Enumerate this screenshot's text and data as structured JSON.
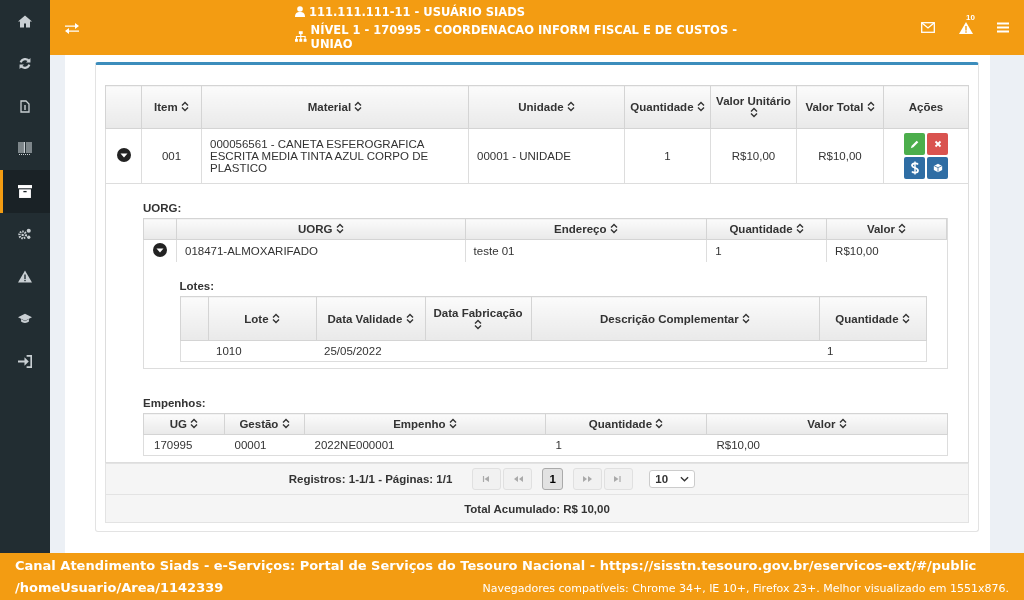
{
  "sidebar": {
    "items": [
      {
        "selected": false
      },
      {
        "selected": false
      },
      {
        "selected": false
      },
      {
        "selected": false
      },
      {
        "selected": true
      },
      {
        "selected": false
      },
      {
        "selected": false
      },
      {
        "selected": false
      },
      {
        "selected": false
      }
    ]
  },
  "header": {
    "user": "111.111.111-11 - USUÁRIO SIADS",
    "level": "NÍVEL 1 - 170995 - COORDENACAO INFORM FISCAL E DE CUSTOS - UNIAO",
    "alerts_count": "10"
  },
  "items_table": {
    "columns": [
      {
        "label": "Item",
        "sortable": true
      },
      {
        "label": "Material",
        "sortable": true
      },
      {
        "label": "Unidade",
        "sortable": true
      },
      {
        "label": "Quantidade",
        "sortable": true
      },
      {
        "label": "Valor Unitário",
        "sortable": true
      },
      {
        "label": "Valor Total",
        "sortable": true
      },
      {
        "label": "Ações",
        "sortable": false
      }
    ],
    "rows": [
      {
        "expanded": true,
        "cells": [
          "001",
          "000056561 - CANETA ESFEROGRAFICA ESCRITA MEDIA TINTA AZUL CORPO DE PLASTICO",
          "00001 - UNIDADE",
          "1",
          "R$10,00",
          "R$10,00"
        ],
        "actions": [
          {
            "kind": "edit"
          },
          {
            "kind": "delete"
          },
          {
            "kind": "payment"
          },
          {
            "kind": "package"
          }
        ],
        "uorg": {
          "title": "UORG:",
          "columns": [
            {
              "label": "UORG",
              "sortable": true
            },
            {
              "label": "Endereço",
              "sortable": true
            },
            {
              "label": "Quantidade",
              "sortable": true
            },
            {
              "label": "Valor",
              "sortable": true
            }
          ],
          "rows": [
            {
              "expanded": true,
              "cells": [
                "018471-ALMOXARIFADO",
                "teste 01",
                "1",
                "R$10,00"
              ],
              "lotes": {
                "title": "Lotes:",
                "columns": [
                  {
                    "label": "Lote",
                    "sortable": true
                  },
                  {
                    "label": "Data Validade",
                    "sortable": true
                  },
                  {
                    "label": "Data Fabricação",
                    "sortable": true
                  },
                  {
                    "label": "Descrição Complementar",
                    "sortable": true
                  },
                  {
                    "label": "Quantidade",
                    "sortable": true
                  }
                ],
                "rows": [
                  {
                    "lote": "1010",
                    "data_validade": "25/05/2022",
                    "quantidade": "1"
                  }
                ]
              }
            }
          ]
        },
        "empenhos": {
          "title": "Empenhos:",
          "columns": [
            {
              "label": "UG",
              "sortable": true
            },
            {
              "label": "Gestão",
              "sortable": true
            },
            {
              "label": "Empenho",
              "sortable": true
            },
            {
              "label": "Quantidade",
              "sortable": true
            },
            {
              "label": "Valor",
              "sortable": true
            }
          ],
          "rows": [
            {
              "cells": [
                "170995",
                "00001",
                "2022NE000001",
                "1",
                "R$10,00"
              ]
            }
          ]
        }
      }
    ]
  },
  "pagination": {
    "summary": "Registros: 1-1/1 - Páginas: 1/1",
    "before": [
      {
        "kind": "first",
        "disabled": true
      },
      {
        "kind": "prev",
        "disabled": true
      }
    ],
    "pages": [
      {
        "label": "1",
        "selected": true
      }
    ],
    "after": [
      {
        "kind": "next",
        "disabled": true
      },
      {
        "kind": "last",
        "disabled": true
      }
    ],
    "page_size": "10"
  },
  "total": "Total Acumulado: R$ 10,00",
  "footer": {
    "lines": [
      "Canal Atendimento Siads - e-Serviços: Portal de Serviços do Tesouro Nacional - https://sisstn.tesouro.gov.br/eservicos-ext/#/public",
      "/homeUsuario/Area/1142339"
    ],
    "compat": "Navegadores compatíveis: Chrome 34+, IE 10+, Firefox 23+. Melhor visualizado em 1551x876."
  }
}
